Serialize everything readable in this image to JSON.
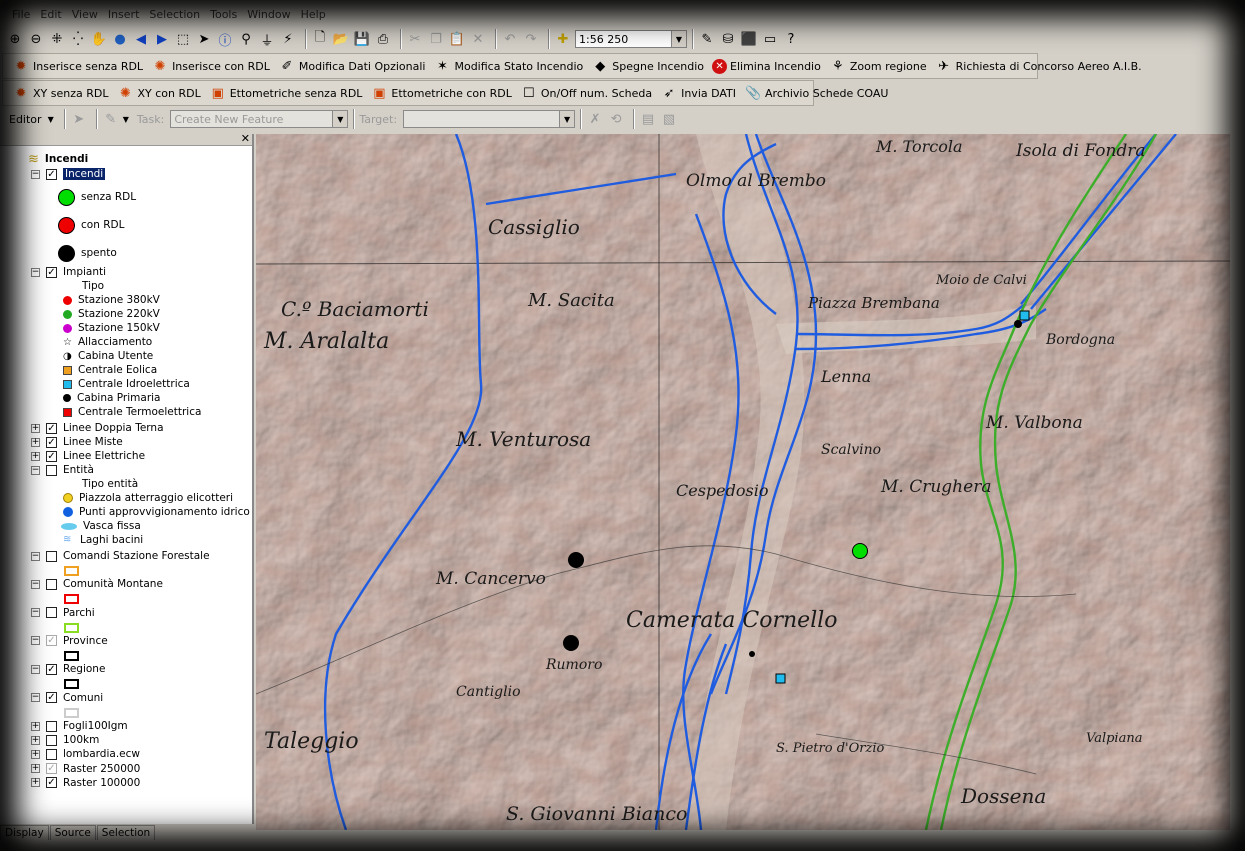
{
  "menu": [
    "File",
    "Edit",
    "View",
    "Insert",
    "Selection",
    "Tools",
    "Window",
    "Help"
  ],
  "standard_toolbar": {
    "scale_value": "1:56 250"
  },
  "toolbar_incendi": [
    {
      "label": "Inserisce senza RDL",
      "icon": "flame-icon"
    },
    {
      "label": "Inserisce con RDL",
      "icon": "flame-plus-icon"
    },
    {
      "label": "Modifica Dati Opzionali",
      "icon": "edit-data-icon"
    },
    {
      "label": "Modifica Stato Incendio",
      "icon": "flame-state-icon"
    },
    {
      "label": "Spegne Incendio",
      "icon": "extinguish-icon"
    },
    {
      "label": "Elimina Incendio",
      "icon": "delete-icon"
    },
    {
      "label": "Zoom regione",
      "icon": "zoom-region-icon"
    },
    {
      "label": "Richiesta di Concorso Aereo A.I.B.",
      "icon": "aircraft-icon"
    }
  ],
  "toolbar_coords": [
    {
      "label": "XY senza RDL",
      "icon": "xy-icon"
    },
    {
      "label": "XY con RDL",
      "icon": "xy-rdl-icon"
    },
    {
      "label": "Ettometriche senza RDL",
      "icon": "ettometric-icon"
    },
    {
      "label": "Ettometriche con RDL",
      "icon": "ettometric-rdl-icon"
    },
    {
      "label": "On/Off num. Scheda",
      "icon": "toggle-icon"
    },
    {
      "label": "Invia DATI",
      "icon": "send-icon"
    },
    {
      "label": "Archivio Schede COAU",
      "icon": "paperclip-icon"
    }
  ],
  "editor_toolbar": {
    "editor_label": "Editor",
    "task_label": "Task:",
    "task_value": "Create New Feature",
    "target_label": "Target:",
    "target_value": ""
  },
  "toc": {
    "root": "Incendi",
    "incendi_layer": "Incendi",
    "incendi_symbols": [
      {
        "label": "senza RDL",
        "color": "#00dd00"
      },
      {
        "label": "con RDL",
        "color": "#ee0000"
      },
      {
        "label": "spento",
        "color": "#000000"
      }
    ],
    "impianti_layer": "Impianti",
    "impianti_field": "Tipo",
    "impianti_symbols": [
      {
        "label": "Stazione 380kV",
        "color": "#ee0000"
      },
      {
        "label": "Stazione 220kV",
        "color": "#22aa22"
      },
      {
        "label": "Stazione 150kV",
        "color": "#cc00cc"
      },
      {
        "label": "Allacciamento",
        "color": "#000000"
      },
      {
        "label": "Cabina Utente",
        "color": "#000000"
      },
      {
        "label": "Centrale Eolica",
        "color": "#f0a020"
      },
      {
        "label": "Centrale Idroelettrica",
        "color": "#22bbee"
      },
      {
        "label": "Cabina Primaria",
        "color": "#000000"
      },
      {
        "label": "Centrale Termoelettrica",
        "color": "#ee0000"
      }
    ],
    "lines": [
      "Linee Doppia Terna",
      "Linee Miste",
      "Linee Elettriche"
    ],
    "entita_layer": "Entità",
    "entita_field": "Tipo entità",
    "entita_symbols": [
      {
        "label": "Piazzola atterraggio elicotteri",
        "color": "#f0d020"
      },
      {
        "label": "Punti approvvigionamento idrico",
        "color": "#1060e0"
      },
      {
        "label": "Vasca fissa",
        "color": "#66ccee"
      },
      {
        "label": "Laghi bacini",
        "color": "#66aaee"
      }
    ],
    "polygon_layers": [
      {
        "label": "Comandi Stazione Forestale",
        "color": "#f0a020",
        "checked": false
      },
      {
        "label": "Comunità Montane",
        "color": "#ee0000",
        "checked": false
      },
      {
        "label": "Parchi",
        "color": "#88dd22",
        "checked": false
      },
      {
        "label": "Province",
        "color": "#000000",
        "checked": true,
        "disabled": true
      },
      {
        "label": "Regione",
        "color": "#000000",
        "checked": true
      },
      {
        "label": "Comuni",
        "color": "#cccccc",
        "checked": true
      }
    ],
    "bottom_layers": [
      {
        "label": "Fogli100Igm",
        "checked": false
      },
      {
        "label": "100km",
        "checked": false
      },
      {
        "label": "lombardia.ecw",
        "checked": false
      },
      {
        "label": "Raster 250000",
        "checked": true,
        "disabled": true
      },
      {
        "label": "Raster 100000",
        "checked": true
      }
    ]
  },
  "toc_tabs": [
    "Display",
    "Source",
    "Selection"
  ],
  "map_labels": [
    "Cassiglio",
    "Olmo al Brembo",
    "M. Sacita",
    "C.º Baciamorti",
    "M. Aralalta",
    "M. Venturosa",
    "Lenna",
    "Piazza Brembana",
    "Moio de Calvi",
    "M. Valbona",
    "M. Crughera",
    "Scalvino",
    "Cespedosio",
    "M. Cancervo",
    "Camerata Cornello",
    "Rumoro",
    "S. Giovanni Bianco",
    "Dossena",
    "Taleggio",
    "Isola di Fondra",
    "Bordogna",
    "Valpiana",
    "M. Torcola",
    "Cantiglio",
    "S. Pietro d'Orzio"
  ]
}
